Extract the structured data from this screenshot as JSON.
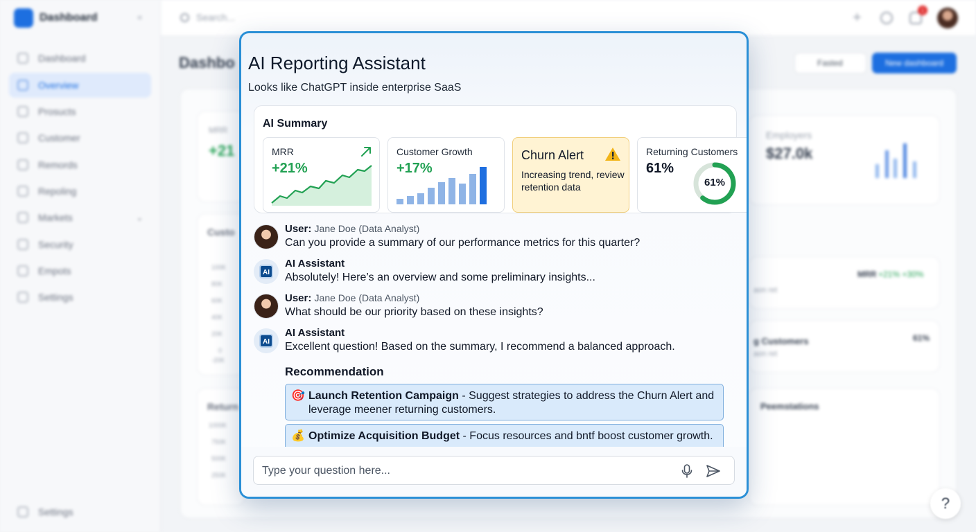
{
  "background": {
    "sidebar": {
      "brand": "Dashboard",
      "items": [
        {
          "label": "Dashboard",
          "active": false
        },
        {
          "label": "Overview",
          "active": true
        },
        {
          "label": "Prosucts",
          "active": false
        },
        {
          "label": "Customer",
          "active": false
        },
        {
          "label": "Remords",
          "active": false
        },
        {
          "label": "Repoling",
          "active": false
        },
        {
          "label": "Markets",
          "active": false
        },
        {
          "label": "Security",
          "active": false
        },
        {
          "label": "Empots",
          "active": false
        },
        {
          "label": "Settings",
          "active": false
        }
      ],
      "footer": "Settings"
    },
    "topbar": {
      "search_placeholder": "Search...",
      "notification_count": "1"
    },
    "page_title": "Dashbo",
    "filter_label": "Fasted",
    "new_dashboard_label": "New dashboard",
    "cards": {
      "mrr_label": "MRR",
      "mrr_value": "+21",
      "employers_label": "Employers",
      "employers_value": "$27.0k",
      "custom_label": "Custo",
      "returns_label": "Return",
      "y_ticks_1": [
        "100K",
        "80K",
        "60K",
        "40K",
        "20K",
        "0",
        "-20K"
      ],
      "y_ticks_2": [
        "1000K",
        "750K",
        "500K",
        "250K"
      ],
      "mrr_row_label": "MRR",
      "mrr_row_values": "+21% +30%",
      "returning_row_label": "g Customers",
      "returning_row_value": "61%",
      "sub_label": "aon ret",
      "presentations_label": "Peemstations"
    }
  },
  "assistant": {
    "title": "AI Reporting Assistant",
    "subtitle": "Looks like ChatGPT inside enterprise SaaS",
    "summary": {
      "heading": "AI Summary",
      "mrr": {
        "label": "MRR",
        "value": "+21%"
      },
      "growth": {
        "label": "Customer Growth",
        "value": "+17%"
      },
      "churn": {
        "title": "Churn Alert",
        "description": "Increasing trend, review retention data"
      },
      "returning": {
        "label": "Returning Customers",
        "value": "61%",
        "ring_label": "61%",
        "ratio": 0.61
      }
    },
    "messages": [
      {
        "sender": "User:",
        "role": "Jane Doe (Data Analyst)",
        "text": "Can you provide a summary of our performance metrics for this quarter?"
      },
      {
        "sender": "AI Assistant",
        "role": "",
        "text": "Absolutely! Here’s an overview and some preliminary insights..."
      },
      {
        "sender": "User:",
        "role": "Jane Doe (Data Analyst)",
        "text": "What should be our priority based on these insights?"
      },
      {
        "sender": "AI Assistant",
        "role": "",
        "text": "Excellent question! Based on the summary, I recommend a balanced approach."
      }
    ],
    "ai_avatar_label": "AI",
    "recommendation_heading": "Recommendation",
    "recommendations": [
      {
        "emoji": "🎯",
        "title": "Launch Retention Campaign",
        "text": " - Suggest strategies to address the Churn Alert and leverage meener returning customers."
      },
      {
        "emoji": "💰",
        "title": "Optimize Acquisition Budget",
        "text": " - Focus resources and bntf boost customer growth."
      }
    ],
    "input_placeholder": "Type your question here...",
    "help_label": "?"
  },
  "colors": {
    "accent": "#1d6fe0",
    "positive": "#22a153",
    "alert_bg": "#fff3d3",
    "modal_border": "#2a8fd6"
  }
}
